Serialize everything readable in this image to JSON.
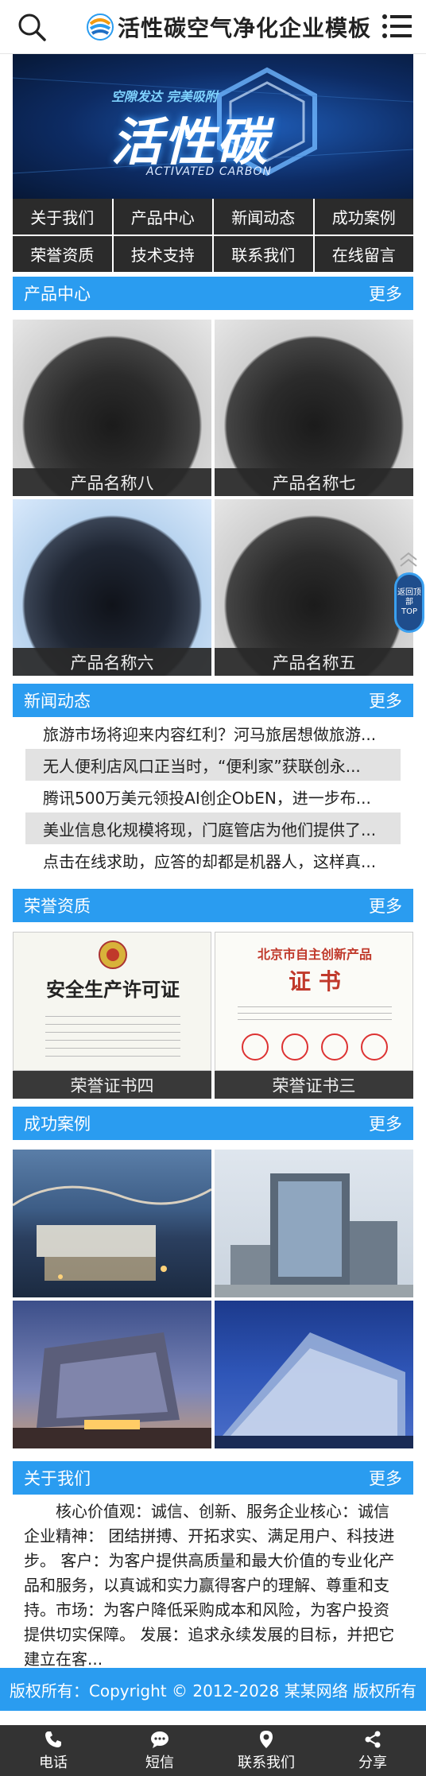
{
  "header": {
    "logo_text": "活性碳空气净化企业模板",
    "search_icon": "search-icon",
    "menu_icon": "menu-icon"
  },
  "banner": {
    "sub": "空隙发达 完美吸附",
    "title": "活性碳",
    "en": "ACTIVATED CARBON"
  },
  "nav": [
    {
      "label": "关于我们"
    },
    {
      "label": "产品中心"
    },
    {
      "label": "新闻动态"
    },
    {
      "label": "成功案例"
    },
    {
      "label": "荣誉资质"
    },
    {
      "label": "技术支持"
    },
    {
      "label": "联系我们"
    },
    {
      "label": "在线留言"
    }
  ],
  "sections": {
    "products": {
      "title": "产品中心",
      "more": "更多"
    },
    "news": {
      "title": "新闻动态",
      "more": "更多"
    },
    "honors": {
      "title": "荣誉资质",
      "more": "更多"
    },
    "cases": {
      "title": "成功案例",
      "more": "更多"
    },
    "about": {
      "title": "关于我们",
      "more": "更多"
    }
  },
  "products": [
    {
      "name": "产品名称八"
    },
    {
      "name": "产品名称七"
    },
    {
      "name": "产品名称六"
    },
    {
      "name": "产品名称五"
    }
  ],
  "news": [
    {
      "title": "旅游市场将迎来内容红利？河马旅居想做旅游..."
    },
    {
      "title": "无人便利店风口正当时，“便利家”获联创永..."
    },
    {
      "title": "腾讯500万美元领投AI创企ObEN，进一步布..."
    },
    {
      "title": "美业信息化规模将现，门庭管店为他们提供了..."
    },
    {
      "title": "点击在线求助，应答的却都是机器人，这样真..."
    }
  ],
  "honors": [
    {
      "name": "荣誉证书四",
      "cert_title": "安全生产许可证"
    },
    {
      "name": "荣誉证书三",
      "cert_header": "北京市自主创新产品",
      "cert_title": "证 书"
    }
  ],
  "about": {
    "text": "核心价值观：诚信、创新、服务企业核心：诚信 企业精神： 团结拼搏、开拓求实、满足用户、科技进步。 客户：为客户提供高质量和最大价值的专业化产品和服务，以真诚和实力赢得客户的理解、尊重和支持。市场：为客户降低采购成本和风险，为客户投资提供切实保障。 发展：追求永续发展的目标，并把它建立在客..."
  },
  "copyright": "版权所有：Copyright © 2012-2028 某某网络 版权所有",
  "backtop": {
    "label": "返回顶部",
    "label_en": "TOP"
  },
  "bottombar": [
    {
      "label": "电话",
      "icon": "phone-icon"
    },
    {
      "label": "短信",
      "icon": "message-icon"
    },
    {
      "label": "联系我们",
      "icon": "location-icon"
    },
    {
      "label": "分享",
      "icon": "share-icon"
    }
  ]
}
